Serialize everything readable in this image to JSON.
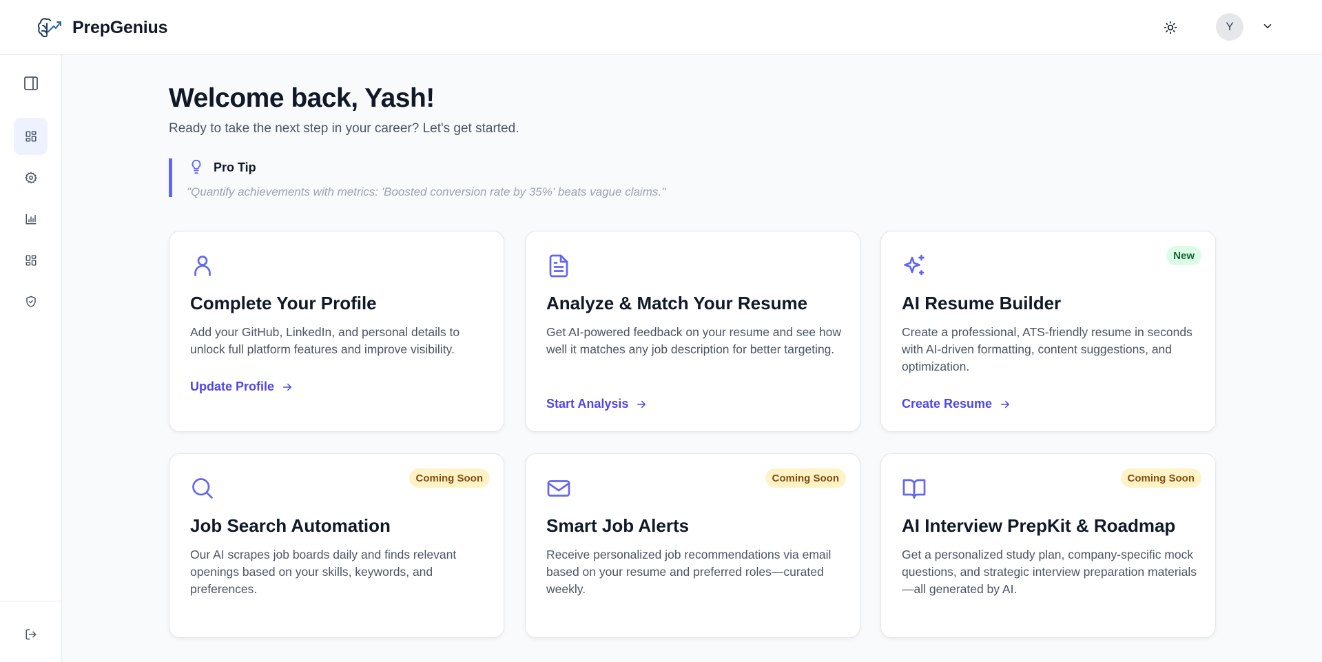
{
  "header": {
    "brand": "PrepGenius",
    "logo_icon": "brain-growth-icon",
    "theme_icon": "sun-icon",
    "avatar_initial": "Y",
    "menu_icon": "chevron-down-icon"
  },
  "sidebar": {
    "items": [
      {
        "icon": "panel-toggle-icon"
      },
      {
        "icon": "dashboard-icon",
        "active": true
      },
      {
        "icon": "settings-icon"
      },
      {
        "icon": "bar-chart-icon"
      },
      {
        "icon": "dashboard-icon"
      },
      {
        "icon": "shield-check-icon"
      }
    ],
    "logout_icon": "logout-icon"
  },
  "main": {
    "welcome": "Welcome back, Yash!",
    "subtitle": "Ready to take the next step in your career? Let's get started.",
    "protip": {
      "title": "Pro Tip",
      "text": "\"Quantify achievements with metrics: 'Boosted conversion rate by 35%' beats vague claims.\"",
      "icon": "lightbulb-icon"
    },
    "cards": [
      {
        "icon": "user-icon",
        "title": "Complete Your Profile",
        "description": "Add your GitHub, LinkedIn, and personal details to unlock full platform features and improve visibility.",
        "cta": "Update Profile",
        "badge": ""
      },
      {
        "icon": "document-icon",
        "title": "Analyze & Match Your Resume",
        "description": "Get AI-powered feedback on your resume and see how well it matches any job description for better targeting.",
        "cta": "Start Analysis",
        "badge": ""
      },
      {
        "icon": "sparkles-icon",
        "title": "AI Resume Builder",
        "description": "Create a professional, ATS-friendly resume in seconds with AI-driven formatting, content suggestions, and optimization.",
        "cta": "Create Resume",
        "badge": "New"
      },
      {
        "icon": "search-icon",
        "title": "Job Search Automation",
        "description": "Our AI scrapes job boards daily and finds relevant openings based on your skills, keywords, and preferences.",
        "cta": "",
        "badge": "Coming Soon"
      },
      {
        "icon": "mail-icon",
        "title": "Smart Job Alerts",
        "description": "Receive personalized job recommendations via email based on your resume and preferred roles—curated weekly.",
        "cta": "",
        "badge": "Coming Soon"
      },
      {
        "icon": "book-open-icon",
        "title": "AI Interview PrepKit & Roadmap",
        "description": "Get a personalized study plan, company-specific mock questions, and strategic interview preparation materials—all generated by AI.",
        "cta": "",
        "badge": "Coming Soon"
      }
    ]
  },
  "colors": {
    "accent": "#4f46e5",
    "icon_accent": "#6366f1",
    "new_badge_bg": "#dcfce7",
    "soon_badge_bg": "#fef3c7"
  }
}
